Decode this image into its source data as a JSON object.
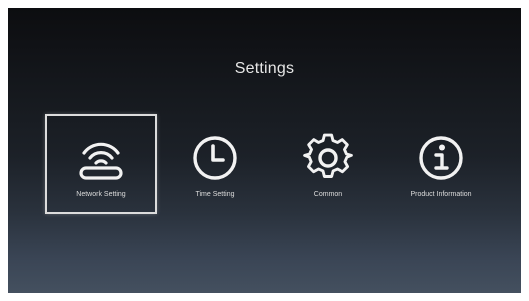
{
  "screen": {
    "title": "Settings",
    "colors": {
      "background_top": "#0c0d10",
      "background_bottom": "#44505f",
      "text": "#e6e6e6",
      "selection_border": "#dcdcdc"
    }
  },
  "menu": {
    "selected_index": 0,
    "items": [
      {
        "label": "Network Setting",
        "icon": "wifi-router-icon"
      },
      {
        "label": "Time Setting",
        "icon": "clock-icon"
      },
      {
        "label": "Common",
        "icon": "gear-icon"
      },
      {
        "label": "Product Information",
        "icon": "info-icon"
      }
    ]
  }
}
